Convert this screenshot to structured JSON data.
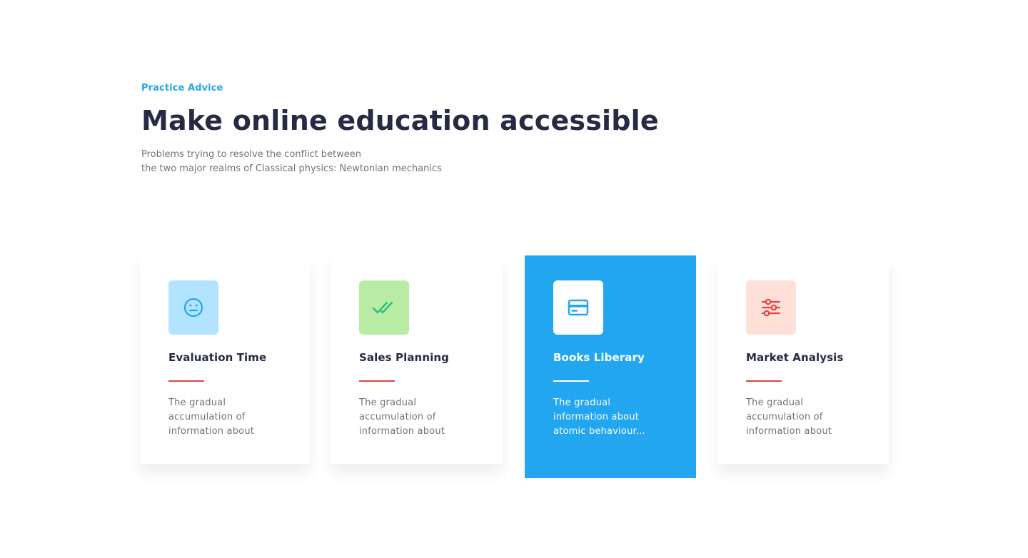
{
  "section": {
    "eyebrow": "Practice Advice",
    "title": "Make online education accessible",
    "subtitle_line1": "Problems trying to resolve the conflict between",
    "subtitle_line2": "the two major realms of Classical physics: Newtonian mechanics"
  },
  "cards": [
    {
      "title": "Evaluation Time",
      "description": "The gradual accumulation of information about",
      "icon": "neutral-face-icon",
      "icon_bg": "#b2e3ff",
      "icon_color": "#23a6f0",
      "active": false
    },
    {
      "title": "Sales Planning",
      "description": "The gradual accumulation of information about",
      "icon": "double-check-icon",
      "icon_bg": "#b8eca5",
      "icon_color": "#2dc071",
      "active": false
    },
    {
      "title": "Books Liberary",
      "description": "The gradual information about atomic behaviour...",
      "icon": "credit-card-icon",
      "icon_bg": "#ffffff",
      "icon_color": "#23a6f0",
      "active": true
    },
    {
      "title": "Market Analysis",
      "description": "The gradual accumulation of information about",
      "icon": "sliders-icon",
      "icon_bg": "#ffe0d8",
      "icon_color": "#e74040",
      "active": false
    }
  ],
  "colors": {
    "accent": "#23a6f0",
    "heading": "#252b42",
    "muted": "#737373",
    "danger": "#e74040"
  }
}
